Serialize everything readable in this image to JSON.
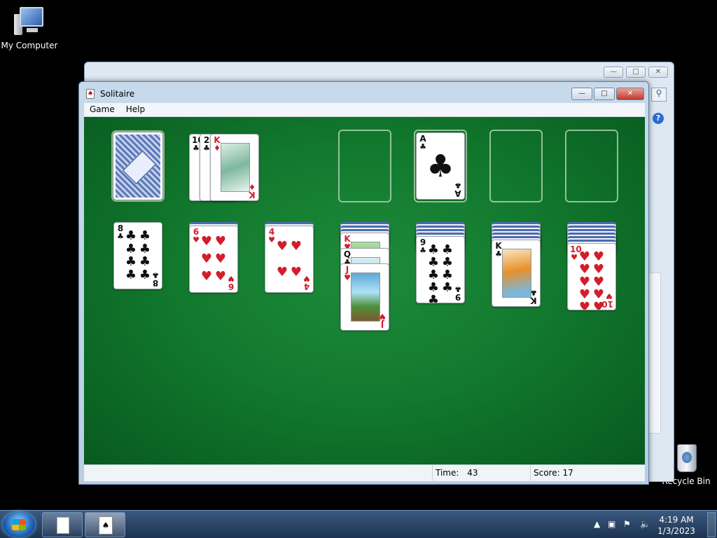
{
  "desktop": {
    "icons": [
      {
        "label": "My Computer",
        "icon": "computer-icon"
      },
      {
        "label": "Recycle Bin",
        "icon": "recycle-bin-icon"
      }
    ]
  },
  "background_window": {
    "controls": [
      "minimize",
      "maximize",
      "close"
    ],
    "icons": [
      "search-icon",
      "help-icon"
    ]
  },
  "window": {
    "title": "Solitaire",
    "menu": [
      "Game",
      "Help"
    ],
    "controls": [
      "minimize",
      "maximize",
      "close"
    ]
  },
  "status": {
    "time_label": "Time:",
    "time_value": "43",
    "score_label": "Score:",
    "score_value": "17"
  },
  "board": {
    "stock": {
      "face": "down"
    },
    "waste": [
      {
        "rank": "10",
        "suit": "♣",
        "color": "black"
      },
      {
        "rank": "2",
        "suit": "♣",
        "color": "black"
      },
      {
        "rank": "K",
        "suit": "♦",
        "color": "red"
      }
    ],
    "foundations": [
      {
        "empty": true
      },
      {
        "rank": "A",
        "suit": "♣",
        "color": "black"
      },
      {
        "empty": true
      },
      {
        "empty": true
      }
    ],
    "tableau": [
      {
        "hidden": 0,
        "cards": [
          {
            "rank": "8",
            "suit": "♣",
            "color": "black"
          }
        ]
      },
      {
        "hidden": 1,
        "cards": [
          {
            "rank": "6",
            "suit": "♥",
            "color": "red"
          }
        ]
      },
      {
        "hidden": 1,
        "cards": [
          {
            "rank": "4",
            "suit": "♥",
            "color": "red"
          }
        ]
      },
      {
        "hidden": 3,
        "cards": [
          {
            "rank": "K",
            "suit": "♥",
            "color": "red"
          },
          {
            "rank": "Q",
            "suit": "♣",
            "color": "black"
          },
          {
            "rank": "J",
            "suit": "♥",
            "color": "red"
          }
        ]
      },
      {
        "hidden": 4,
        "cards": [
          {
            "rank": "9",
            "suit": "♣",
            "color": "black"
          }
        ]
      },
      {
        "hidden": 5,
        "cards": [
          {
            "rank": "K",
            "suit": "♣",
            "color": "black"
          }
        ]
      },
      {
        "hidden": 6,
        "cards": [
          {
            "rank": "10",
            "suit": "♥",
            "color": "red"
          }
        ]
      }
    ]
  },
  "taskbar": {
    "items": [
      "notepad",
      "solitaire"
    ],
    "clock_time": "4:19 AM",
    "clock_date": "1/3/2023"
  },
  "colors": {
    "felt": "#127a2e",
    "red_suit": "#d21d2c",
    "black_suit": "#111111"
  }
}
